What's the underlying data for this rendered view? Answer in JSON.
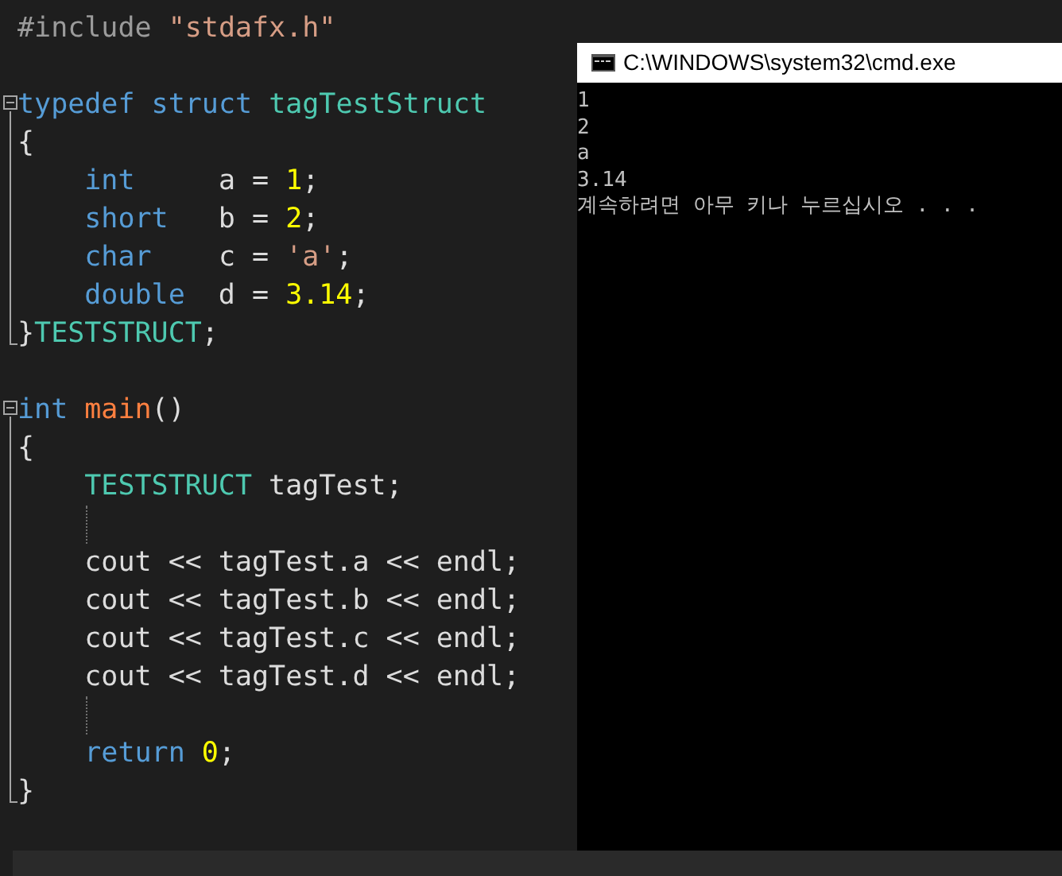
{
  "editor": {
    "lines": [
      {
        "tokens": [
          {
            "kind": "preprocessor",
            "text": "#include"
          },
          {
            "kind": "string",
            "text": " \"stdafx.h\""
          }
        ]
      },
      {
        "fold_start": true,
        "tokens": [
          {
            "kind": "keyword",
            "text": "typedef"
          },
          {
            "kind": "keyword",
            "text": " struct"
          },
          {
            "kind": "type",
            "text": " tagTestStruct"
          }
        ]
      },
      {
        "tokens": [
          {
            "kind": "plain",
            "text": "{"
          }
        ]
      },
      {
        "tokens": [
          {
            "kind": "keyword",
            "text": "    int"
          },
          {
            "kind": "plain",
            "text": "     a = "
          },
          {
            "kind": "number",
            "text": "1"
          },
          {
            "kind": "plain",
            "text": ";"
          }
        ]
      },
      {
        "tokens": [
          {
            "kind": "keyword",
            "text": "    short"
          },
          {
            "kind": "plain",
            "text": "   b = "
          },
          {
            "kind": "number",
            "text": "2"
          },
          {
            "kind": "plain",
            "text": ";"
          }
        ]
      },
      {
        "tokens": [
          {
            "kind": "keyword",
            "text": "    char"
          },
          {
            "kind": "plain",
            "text": "    c = "
          },
          {
            "kind": "string",
            "text": "'a'"
          },
          {
            "kind": "plain",
            "text": ";"
          }
        ]
      },
      {
        "tokens": [
          {
            "kind": "keyword",
            "text": "    double"
          },
          {
            "kind": "plain",
            "text": "  d = "
          },
          {
            "kind": "number",
            "text": "3.14"
          },
          {
            "kind": "plain",
            "text": ";"
          }
        ]
      },
      {
        "fold_end": true,
        "tokens": [
          {
            "kind": "plain",
            "text": "}"
          },
          {
            "kind": "type",
            "text": "TESTSTRUCT"
          },
          {
            "kind": "plain",
            "text": ";"
          }
        ]
      },
      {
        "fold_start": true,
        "tokens": [
          {
            "kind": "keyword",
            "text": "int"
          },
          {
            "kind": "function",
            "text": " main"
          },
          {
            "kind": "plain",
            "text": "()"
          }
        ]
      },
      {
        "tokens": [
          {
            "kind": "plain",
            "text": "{"
          }
        ]
      },
      {
        "tokens": [
          {
            "kind": "type",
            "text": "    TESTSTRUCT"
          },
          {
            "kind": "plain",
            "text": " tagTest;"
          }
        ]
      },
      {
        "indent_guide": true
      },
      {
        "tokens": [
          {
            "kind": "plain",
            "text": "    cout << tagTest.a << endl;"
          }
        ]
      },
      {
        "tokens": [
          {
            "kind": "plain",
            "text": "    cout << tagTest.b << endl;"
          }
        ]
      },
      {
        "tokens": [
          {
            "kind": "plain",
            "text": "    cout << tagTest.c << endl;"
          }
        ]
      },
      {
        "tokens": [
          {
            "kind": "plain",
            "text": "    cout << tagTest.d << endl;"
          }
        ]
      },
      {
        "indent_guide": true
      },
      {
        "tokens": [
          {
            "kind": "keyword",
            "text": "    return"
          },
          {
            "kind": "number",
            "text": " 0"
          },
          {
            "kind": "plain",
            "text": ";"
          }
        ]
      },
      {
        "fold_end": true,
        "tokens": [
          {
            "kind": "plain",
            "text": "}"
          }
        ]
      }
    ]
  },
  "console": {
    "title": "C:\\WINDOWS\\system32\\cmd.exe",
    "lines": [
      "1",
      "2",
      "a",
      "3.14",
      "계속하려면 아무 키나 누르십시오 . . ."
    ]
  }
}
